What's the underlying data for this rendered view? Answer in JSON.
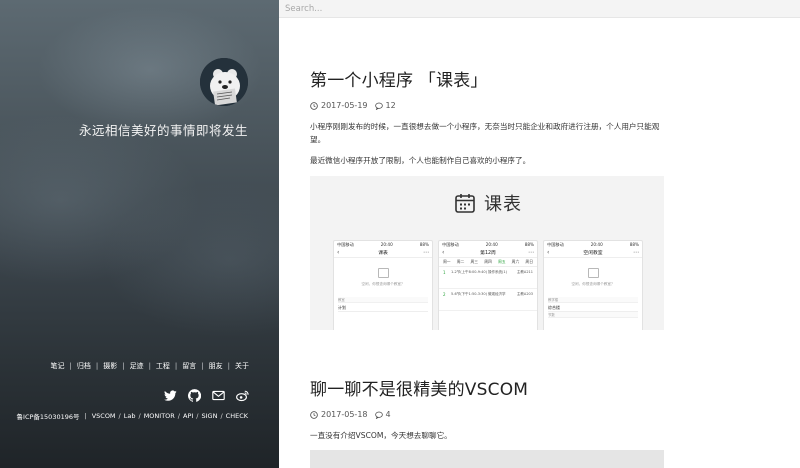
{
  "search": {
    "placeholder": "Search..."
  },
  "profile": {
    "motto": "永远相信美好的事情即将发生"
  },
  "nav": {
    "items": [
      {
        "label": "笔记"
      },
      {
        "label": "归档"
      },
      {
        "label": "摄影"
      },
      {
        "label": "足迹"
      },
      {
        "label": "工程"
      },
      {
        "label": "留言"
      },
      {
        "label": "朋友"
      },
      {
        "label": "关于"
      }
    ],
    "separator": "|"
  },
  "social": [
    {
      "icon": "twitter-icon"
    },
    {
      "icon": "github-icon"
    },
    {
      "icon": "mail-icon"
    },
    {
      "icon": "weibo-icon"
    }
  ],
  "footer": {
    "icp": "鲁ICP备15030196号",
    "links": [
      "VSCOM",
      "Lab",
      "MONITOR",
      "API",
      "SIGN",
      "CHECK"
    ]
  },
  "posts": [
    {
      "title": "第一个小程序 「课表」",
      "date": "2017-05-19",
      "comments": "12",
      "excerpt": [
        "小程序刚刚发布的时候，一直很想去做一个小程序，无奈当时只能企业和政府进行注册，个人用户只能观望。",
        "最近微信小程序开放了限制，个人也能制作自己喜欢的小程序了。"
      ],
      "cover": {
        "title": "课表",
        "phones": [
          {
            "carrier": "中国移动",
            "time": "20:40",
            "battery": "88%",
            "header": "课表",
            "empty": "空闲，你想查询哪个教室？",
            "sections": [
              {
                "label": "教室",
                "value": "计划"
              }
            ]
          },
          {
            "carrier": "中国移动",
            "time": "20:40",
            "battery": "88%",
            "header": "第12周",
            "tabs": [
              "周一",
              "周二",
              "周三",
              "周四",
              "周五",
              "周六",
              "周日"
            ],
            "active_tab": "周五",
            "rows": [
              {
                "num": "1",
                "text": "1-2节(上午8:00-9:40)\n操作系统(1)",
                "room": "主教A211"
              },
              {
                "num": "2",
                "text": "5-6节(下午1:50-3:30)\n微观经济学",
                "room": "主教A203"
              }
            ]
          },
          {
            "carrier": "中国移动",
            "time": "20:40",
            "battery": "88%",
            "header": "空闲教室",
            "empty": "空闲，你想查询哪个教室？",
            "sections": [
              {
                "label": "教学楼",
                "value": "综合楼"
              },
              {
                "label": "节数",
                "value": ""
              }
            ]
          }
        ]
      }
    },
    {
      "title": "聊一聊不是很精美的VSCOM",
      "date": "2017-05-18",
      "comments": "4",
      "excerpt": [
        "一直没有介绍VSCOM，今天想去聊聊它。"
      ]
    }
  ]
}
